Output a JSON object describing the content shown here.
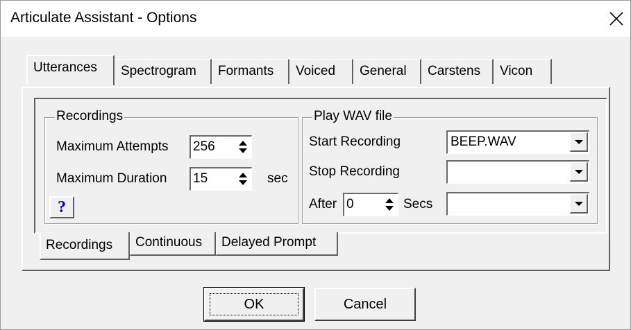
{
  "window": {
    "title": "Articulate Assistant - Options",
    "close_icon": "close-icon"
  },
  "top_tabs": [
    {
      "label": "Utterances",
      "active": true
    },
    {
      "label": "Spectrogram",
      "active": false
    },
    {
      "label": "Formants",
      "active": false
    },
    {
      "label": "Voiced",
      "active": false
    },
    {
      "label": "General",
      "active": false
    },
    {
      "label": "Carstens",
      "active": false
    },
    {
      "label": "Vicon",
      "active": false
    }
  ],
  "recordings_group": {
    "legend": "Recordings",
    "max_attempts_label": "Maximum Attempts",
    "max_attempts_value": "256",
    "max_duration_label": "Maximum Duration",
    "max_duration_value": "15",
    "duration_unit": "sec",
    "help_label": "?"
  },
  "wav_group": {
    "legend": "Play WAV file",
    "start_label": "Start Recording",
    "start_value": "BEEP.WAV",
    "stop_label": "Stop Recording",
    "stop_value": "",
    "after_label": "After",
    "after_value": "0",
    "secs_label": "Secs",
    "after_select_value": ""
  },
  "bottom_tabs": [
    {
      "label": "Recordings",
      "active": true
    },
    {
      "label": "Continuous",
      "active": false
    },
    {
      "label": "Delayed Prompt",
      "active": false
    }
  ],
  "buttons": {
    "ok": "OK",
    "cancel": "Cancel"
  }
}
